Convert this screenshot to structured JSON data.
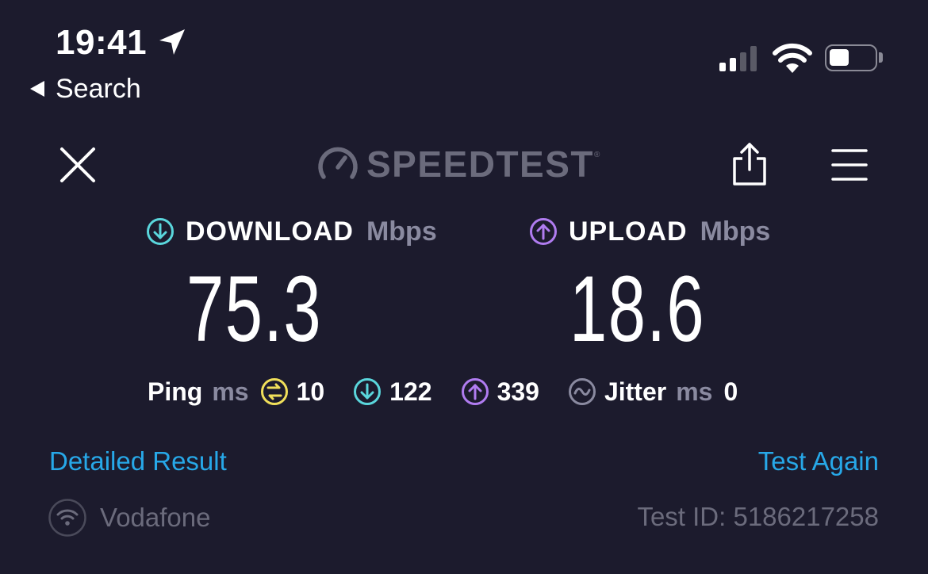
{
  "status_bar": {
    "time": "19:41",
    "back_label": "Search",
    "signal_bars_active": 2,
    "signal_bars_total": 4,
    "battery_level": 0.45
  },
  "toolbar": {
    "brand": "SPEEDTEST",
    "brand_mark": "®",
    "icons": [
      "close-icon",
      "speedometer-icon",
      "share-icon",
      "menu-icon"
    ]
  },
  "results": {
    "download": {
      "label": "DOWNLOAD",
      "unit": "Mbps",
      "value": "75.3",
      "icon": "download-arrow-icon"
    },
    "upload": {
      "label": "UPLOAD",
      "unit": "Mbps",
      "value": "18.6",
      "icon": "upload-arrow-icon"
    }
  },
  "ping": {
    "label": "Ping",
    "unit": "ms",
    "idle": "10",
    "download": "122",
    "upload": "339",
    "jitter_label": "Jitter",
    "jitter_unit": "ms",
    "jitter": "0"
  },
  "links": {
    "detailed": "Detailed Result",
    "test_again": "Test Again"
  },
  "footer": {
    "isp": "Vodafone",
    "test_id": "Test ID: 5186217258"
  },
  "colors": {
    "background": "#1c1b2d",
    "download": "#5ad6dc",
    "upload": "#b07cf0",
    "idle_ping": "#f0df5a",
    "link": "#27a8e8",
    "muted": "#8a8aa0"
  }
}
